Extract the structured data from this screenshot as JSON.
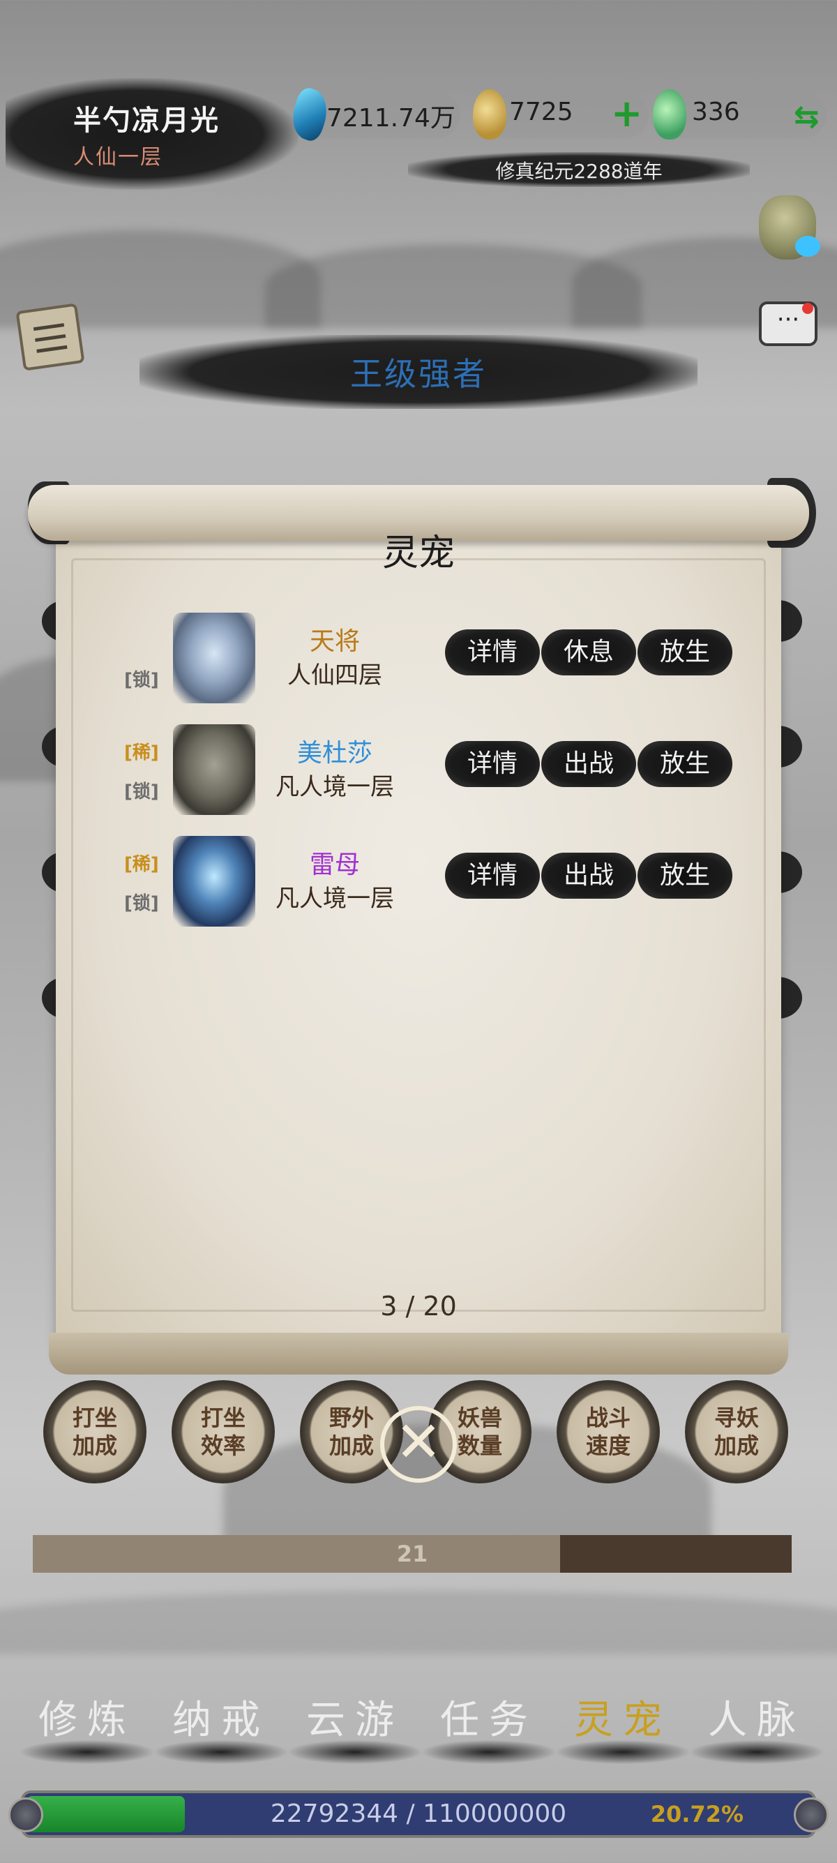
{
  "player": {
    "name": "半勺凉月光",
    "rank": "人仙一层"
  },
  "resources": {
    "spirit_stones": "7211.74万",
    "gold": "7725",
    "jade": "336"
  },
  "era": "修真纪元2288道年",
  "banner_title": "王级强者",
  "modal": {
    "title": "灵宠",
    "pets": [
      {
        "name": "天将",
        "name_color": "#b97a19",
        "level": "人仙四层",
        "tags": [
          "[锁]"
        ],
        "actions": [
          "详情",
          "休息",
          "放生"
        ]
      },
      {
        "name": "美杜莎",
        "name_color": "#2f8fd8",
        "level": "凡人境一层",
        "tags": [
          "[稀]",
          "[锁]"
        ],
        "actions": [
          "详情",
          "出战",
          "放生"
        ]
      },
      {
        "name": "雷母",
        "name_color": "#a230d2",
        "level": "凡人境一层",
        "tags": [
          "[稀]",
          "[锁]"
        ],
        "actions": [
          "详情",
          "出战",
          "放生"
        ]
      }
    ],
    "page_count": "3 / 20"
  },
  "stat_buttons": [
    {
      "line1": "打坐",
      "line2": "加成"
    },
    {
      "line1": "打坐",
      "line2": "效率"
    },
    {
      "line1": "野外",
      "line2": "加成"
    },
    {
      "line1": "妖兽",
      "line2": "数量"
    },
    {
      "line1": "战斗",
      "line2": "速度"
    },
    {
      "line1": "寻妖",
      "line2": "加成"
    }
  ],
  "level_progress": {
    "label": "21",
    "fraction": 0.695
  },
  "nav": [
    "修炼",
    "纳戒",
    "云游",
    "任务",
    "灵宠",
    "人脉"
  ],
  "nav_active_index": 4,
  "experience": {
    "text": "22792344 / 110000000",
    "percent": "20.72%",
    "fraction": 0.2072
  },
  "colors": {
    "accent_gold": "#c8a020",
    "ink": "#1b1b1b",
    "parchment": "#e8e2d6"
  }
}
